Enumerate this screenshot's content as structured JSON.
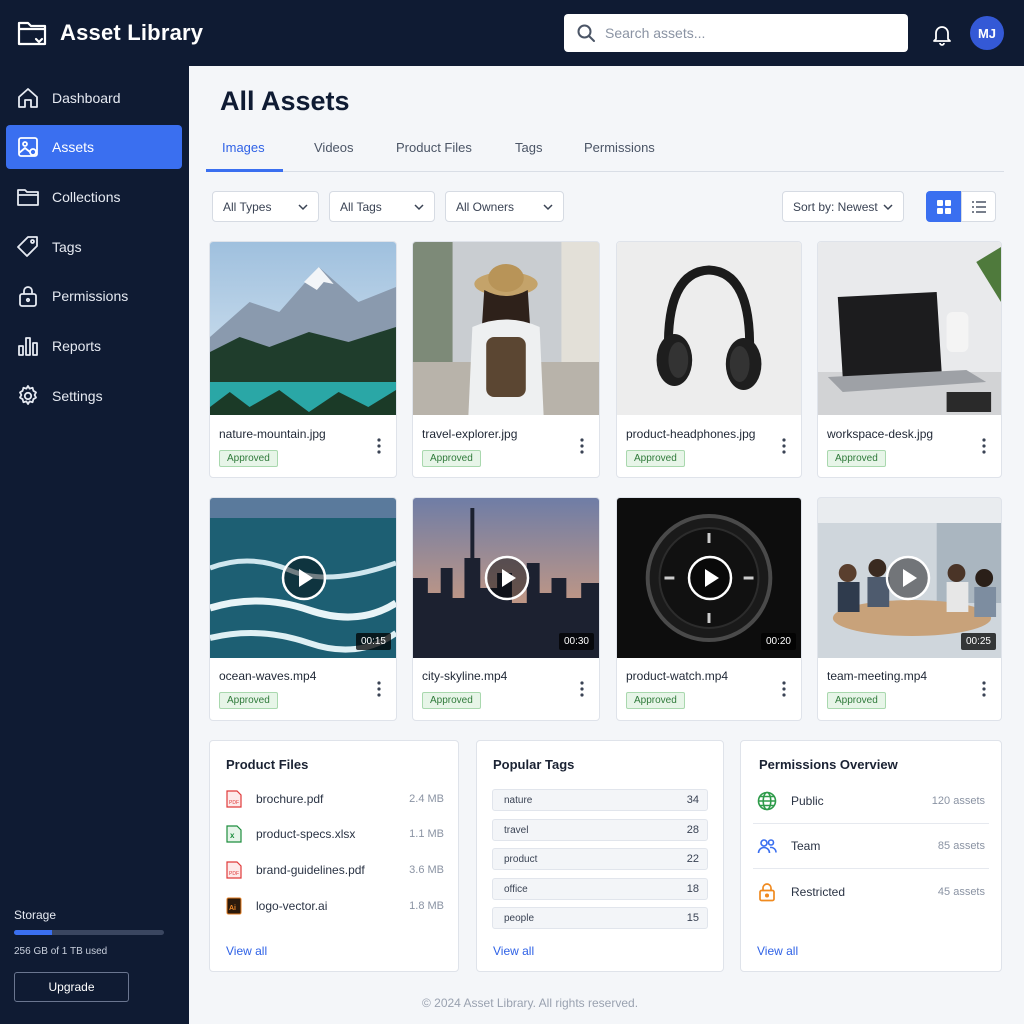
{
  "app": {
    "title": "Asset Library",
    "brand_icon": "folder-icon"
  },
  "search": {
    "placeholder": "Search assets..."
  },
  "user": {
    "initials": "MJ"
  },
  "sidebar": {
    "items": [
      {
        "label": "Dashboard",
        "icon": "home-icon",
        "active": false
      },
      {
        "label": "Assets",
        "icon": "image-icon",
        "active": true
      },
      {
        "label": "Collections",
        "icon": "folder-icon",
        "active": false
      },
      {
        "label": "Tags",
        "icon": "tag-icon",
        "active": false
      },
      {
        "label": "Permissions",
        "icon": "lock-icon",
        "active": false
      },
      {
        "label": "Reports",
        "icon": "bar-chart-icon",
        "active": false
      },
      {
        "label": "Settings",
        "icon": "gear-icon",
        "active": false
      }
    ],
    "storage": {
      "label": "Storage",
      "used_text": "256 GB of 1 TB used",
      "used_fraction": 0.256
    },
    "upgrade_label": "Upgrade"
  },
  "main": {
    "title": "All Assets",
    "tabs": [
      "Images",
      "Videos",
      "Product Files",
      "Tags",
      "Permissions"
    ],
    "active_tab": "Images",
    "filters": [
      "All Types",
      "All Tags",
      "All Owners"
    ],
    "sort_label": "Sort by: Newest",
    "view_mode": "grid"
  },
  "assets": [
    {
      "name": "nature-mountain.jpg",
      "status": "Approved",
      "type": "image"
    },
    {
      "name": "travel-explorer.jpg",
      "status": "Approved",
      "type": "image"
    },
    {
      "name": "product-headphones.jpg",
      "status": "Approved",
      "type": "image"
    },
    {
      "name": "workspace-desk.jpg",
      "status": "Approved",
      "type": "image"
    },
    {
      "name": "ocean-waves.mp4",
      "status": "Approved",
      "type": "video",
      "duration": "00:15"
    },
    {
      "name": "city-skyline.mp4",
      "status": "Approved",
      "type": "video",
      "duration": "00:30"
    },
    {
      "name": "product-watch.mp4",
      "status": "Approved",
      "type": "video",
      "duration": "00:20"
    },
    {
      "name": "team-meeting.mp4",
      "status": "Approved",
      "type": "video",
      "duration": "00:25"
    }
  ],
  "product_files": {
    "title": "Product Files",
    "files": [
      {
        "name": "brochure.pdf",
        "size": "2.4 MB",
        "icon": "pdf-file-icon"
      },
      {
        "name": "product-specs.xlsx",
        "size": "1.1 MB",
        "icon": "excel-file-icon"
      },
      {
        "name": "brand-guidelines.pdf",
        "size": "3.6 MB",
        "icon": "pdf-file-icon"
      },
      {
        "name": "logo-vector.ai",
        "size": "1.8 MB",
        "icon": "illustrator-file-icon"
      }
    ],
    "view_all": "View all"
  },
  "popular_tags": {
    "title": "Popular Tags",
    "tags": [
      {
        "name": "nature",
        "count": "34"
      },
      {
        "name": "travel",
        "count": "28"
      },
      {
        "name": "product",
        "count": "22"
      },
      {
        "name": "office",
        "count": "18"
      },
      {
        "name": "people",
        "count": "15"
      }
    ],
    "view_all": "View all"
  },
  "permissions_overview": {
    "title": "Permissions Overview",
    "rows": [
      {
        "name": "Public",
        "count": "120 assets",
        "icon": "globe-icon"
      },
      {
        "name": "Team",
        "count": "85 assets",
        "icon": "users-icon"
      },
      {
        "name": "Restricted",
        "count": "45 assets",
        "icon": "lock-icon"
      }
    ],
    "view_all": "View all"
  },
  "footer": {
    "text": "© 2024 Asset Library. All rights reserved."
  },
  "colors": {
    "accent": "#3a6ff0",
    "sidebar_bg": "#0f1b33",
    "approved_green": "#2f7a3a"
  }
}
